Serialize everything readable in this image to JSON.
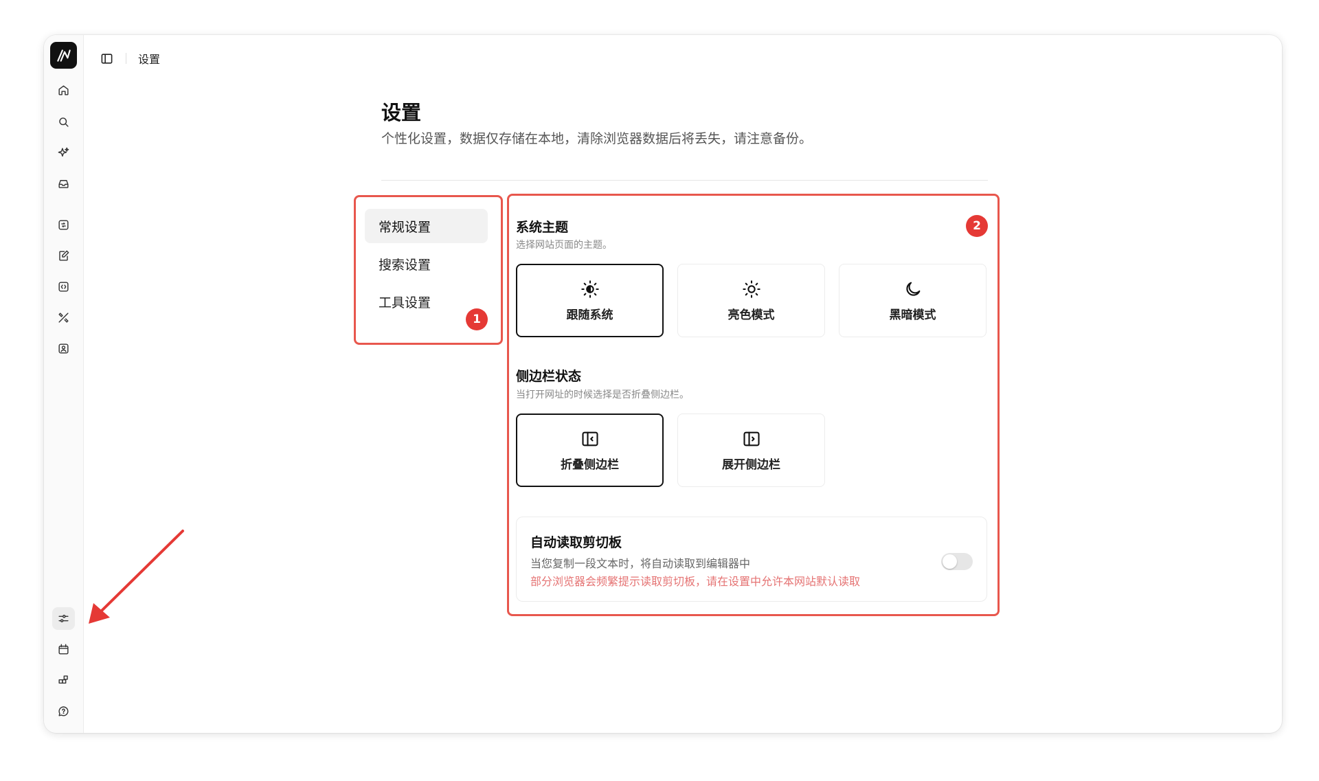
{
  "app": {
    "breadcrumb": "设置"
  },
  "sidebar": {
    "top_icons": [
      "home-icon",
      "search-icon",
      "sparkles-icon",
      "inbox-icon",
      "image-convert-icon",
      "edit-document-icon",
      "code-icon",
      "design-tools-icon",
      "contact-icon"
    ],
    "bottom_icons": [
      "settings-sliders-icon",
      "calendar-icon",
      "widgets-icon",
      "help-chat-icon"
    ],
    "active_icon": "settings-sliders-icon"
  },
  "page": {
    "title": "设置",
    "description": "个性化设置，数据仅存储在本地，清除浏览器数据后将丢失，请注意备份。"
  },
  "nav": {
    "items": [
      {
        "label": "常规设置",
        "active": true
      },
      {
        "label": "搜索设置",
        "active": false
      },
      {
        "label": "工具设置",
        "active": false
      }
    ]
  },
  "theme": {
    "title": "系统主题",
    "description": "选择网站页面的主题。",
    "options": [
      {
        "label": "跟随系统",
        "icon": "sun-auto-icon",
        "selected": true
      },
      {
        "label": "亮色模式",
        "icon": "sun-icon",
        "selected": false
      },
      {
        "label": "黑暗模式",
        "icon": "moon-icon",
        "selected": false
      }
    ]
  },
  "sidebar_state": {
    "title": "侧边栏状态",
    "description": "当打开网址的时候选择是否折叠侧边栏。",
    "options": [
      {
        "label": "折叠侧边栏",
        "icon": "sidebar-collapse-icon",
        "selected": true
      },
      {
        "label": "展开侧边栏",
        "icon": "sidebar-expand-icon",
        "selected": false
      }
    ]
  },
  "clipboard": {
    "title": "自动读取剪切板",
    "description": "当您复制一段文本时，将自动读取到编辑器中",
    "warning": "部分浏览器会频繁提示读取剪切板，请在设置中允许本网站默认读取",
    "enabled": false
  },
  "annotations": {
    "badge_1": "1",
    "badge_2": "2"
  },
  "colors": {
    "highlight": "#e8574d",
    "badge": "#e53935",
    "warning_text": "#e57373"
  }
}
